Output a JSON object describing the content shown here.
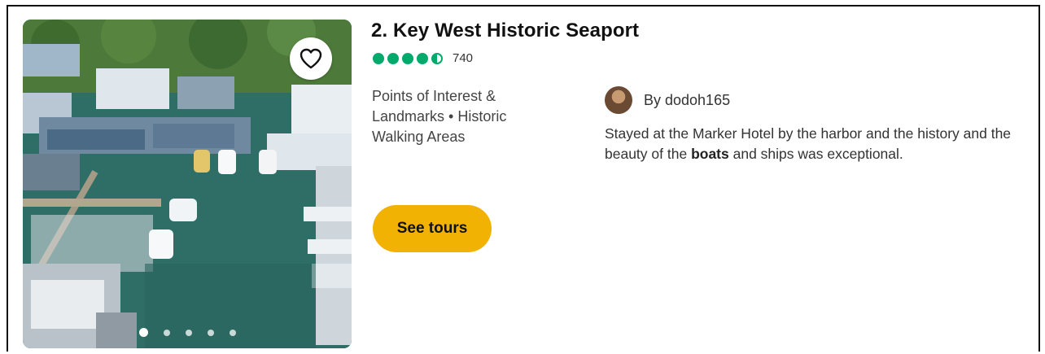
{
  "card": {
    "title": "2. Key West Historic Seaport",
    "rating": {
      "bubbles": 4.5,
      "count": "740",
      "color": "#00aa6c"
    },
    "category": "Points of Interest & Landmarks • Historic Walking Areas",
    "photo": {
      "current_index": 1,
      "total": 5,
      "favorite_icon": "heart-outline-icon"
    },
    "review": {
      "by_label": "By dodoh165",
      "text_before": "Stayed at the Marker Hotel by the harbor and the history and the beauty of the ",
      "text_bold": "boats",
      "text_after": " and ships was exceptional."
    },
    "cta": {
      "label": "See tours",
      "color": "#f2b203"
    }
  }
}
